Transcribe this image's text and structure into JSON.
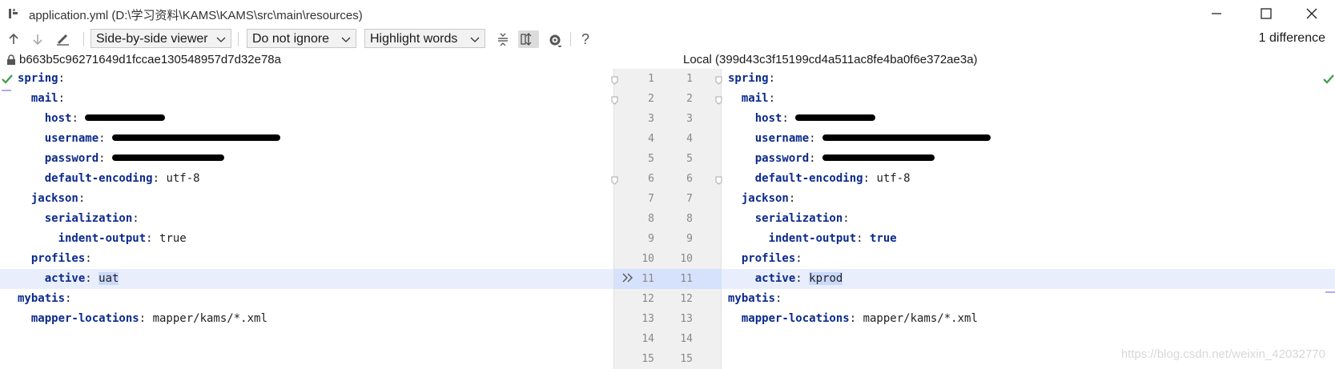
{
  "window": {
    "title": "application.yml (D:\\学习资料\\KAMS\\KAMS\\src\\main\\resources)"
  },
  "toolbar": {
    "viewer_mode": "Side-by-side viewer",
    "ignore_mode": "Do not ignore",
    "highlight_mode": "Highlight words",
    "help_label": "?",
    "difference_count": "1 difference"
  },
  "files": {
    "left_header": "b663b5c96271649d1fccae130548957d7d32e78a",
    "right_header": "Local (399d43c3f15199cd4a511ac8fe4ba0f6e372ae3a)"
  },
  "left_lines": [
    {
      "key": "spring",
      "indent": 0,
      "value": ""
    },
    {
      "key": "mail",
      "indent": 1,
      "value": ""
    },
    {
      "key": "host",
      "indent": 2,
      "value": "",
      "redacted": true
    },
    {
      "key": "username",
      "indent": 2,
      "value": "",
      "redacted": true
    },
    {
      "key": "password",
      "indent": 2,
      "value": "",
      "redacted": true
    },
    {
      "key": "default-encoding",
      "indent": 2,
      "value": "utf-8"
    },
    {
      "key": "jackson",
      "indent": 1,
      "value": ""
    },
    {
      "key": "serialization",
      "indent": 2,
      "value": ""
    },
    {
      "key": "indent-output",
      "indent": 3,
      "value": "true"
    },
    {
      "key": "profiles",
      "indent": 1,
      "value": ""
    },
    {
      "key": "active",
      "indent": 2,
      "value": "uat",
      "changed": true
    },
    {
      "key": "mybatis",
      "indent": 0,
      "value": ""
    },
    {
      "key": "mapper-locations",
      "indent": 1,
      "value": "mapper/kams/*.xml"
    }
  ],
  "right_lines": [
    {
      "key": "spring",
      "indent": 0,
      "value": ""
    },
    {
      "key": "mail",
      "indent": 1,
      "value": ""
    },
    {
      "key": "host",
      "indent": 2,
      "value": "",
      "redacted": true
    },
    {
      "key": "username",
      "indent": 2,
      "value": "",
      "redacted": true
    },
    {
      "key": "password",
      "indent": 2,
      "value": "",
      "redacted": true
    },
    {
      "key": "default-encoding",
      "indent": 2,
      "value": "utf-8"
    },
    {
      "key": "jackson",
      "indent": 1,
      "value": ""
    },
    {
      "key": "serialization",
      "indent": 2,
      "value": ""
    },
    {
      "key": "indent-output",
      "indent": 3,
      "value": "true"
    },
    {
      "key": "profiles",
      "indent": 1,
      "value": ""
    },
    {
      "key": "active",
      "indent": 2,
      "value": "kprod",
      "changed": true
    },
    {
      "key": "mybatis",
      "indent": 0,
      "value": ""
    },
    {
      "key": "mapper-locations",
      "indent": 1,
      "value": "mapper/kams/*.xml"
    }
  ],
  "gutter_numbers": [
    "1",
    "2",
    "3",
    "4",
    "5",
    "6",
    "7",
    "8",
    "9",
    "10",
    "11",
    "12",
    "13",
    "14",
    "15"
  ],
  "changed_line_index": 10,
  "watermark": "https://blog.csdn.net/weixin_42032770",
  "icons": {
    "prev": "arrow-up-icon",
    "next": "arrow-down-icon",
    "edit": "edit-pencil-icon",
    "collapse": "collapse-unchanged-icon",
    "sync": "sync-scroll-icon",
    "settings": "gear-icon",
    "lock": "lock-icon",
    "ok": "check-icon",
    "apply": "apply-change-icon"
  },
  "colors": {
    "keyword": "#0b2a8c",
    "changed_bg": "#e8eefc",
    "changed_word": "#cad9fa",
    "gutter_changed": "#d6e1fb",
    "check": "#3e9a4a"
  }
}
